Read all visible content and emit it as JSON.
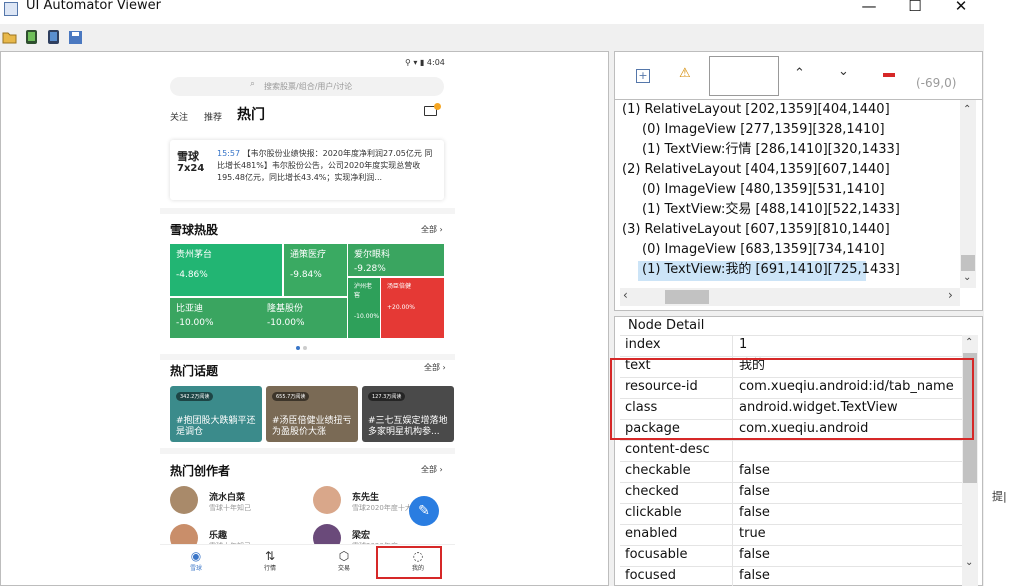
{
  "window": {
    "title": "UI Automator Viewer",
    "min": "—",
    "max": "☐",
    "close": "✕"
  },
  "toolbar": {
    "icons": [
      "folder-open-icon",
      "device-screenshot-icon",
      "device-screenshot-compressed-icon",
      "save-icon"
    ]
  },
  "phone": {
    "status_time": "4:04",
    "search_placeholder": "搜索股票/组合/用户/讨论",
    "tabs": [
      "关注",
      "推荐",
      "热门"
    ],
    "news": {
      "time": "15:57",
      "logo_top": "雪球",
      "logo_bottom": "7x24",
      "text": "【韦尔股份业绩快报：2020年度净利润27.05亿元 同比增长481%】韦尔股份公告，公司2020年度实现总营收195.48亿元，同比增长43.4%；实现净利润..."
    },
    "hot_stocks": {
      "title": "雪球热股",
      "all": "全部 ›",
      "items": [
        {
          "name": "贵州茅台",
          "change": "-4.86%",
          "color": "#22b573"
        },
        {
          "name": "通策医疗",
          "change": "-9.84%",
          "color": "#3aaa62"
        },
        {
          "name": "爱尔眼科",
          "change": "-9.28%",
          "color": "#3aa560"
        },
        {
          "name": "比亚迪",
          "change": "-10.00%",
          "color": "#3aa560"
        },
        {
          "name": "隆基股份",
          "change": "-10.00%",
          "color": "#3aa560"
        },
        {
          "name": "泸州老窖",
          "change": "-10.00%",
          "color": "#2ea05a"
        },
        {
          "name": "汤臣倍健",
          "change": "+20.00%",
          "color": "#e53935"
        }
      ]
    },
    "hot_topics": {
      "title": "热门话题",
      "all": "全部 ›",
      "items": [
        {
          "badge": "342.2万阅读",
          "text": "#抱团股大跌躺平还是调仓"
        },
        {
          "badge": "655.7万阅读",
          "text": "#汤臣倍健业绩扭亏为盈股价大涨"
        },
        {
          "badge": "127.3万阅读",
          "text": "#三七互娱定增落地多家明星机构参..."
        }
      ]
    },
    "creators": {
      "title": "热门创作者",
      "all": "全部 ›",
      "items": [
        {
          "name": "流水白菜",
          "desc": "雪球十年知己"
        },
        {
          "name": "东先生",
          "desc": "雪球2020年度十大..."
        },
        {
          "name": "乐趣",
          "desc": "雪球十年知己"
        },
        {
          "name": "梁宏",
          "desc": "雪球2020年度..."
        }
      ]
    },
    "bottom_nav": [
      "雪球",
      "行情",
      "交易",
      "我的"
    ]
  },
  "hierarchy": {
    "toolbar": {
      "coords": "(-69,0)"
    },
    "rows": [
      "(1) RelativeLayout [202,1359][404,1440]",
      "(0) ImageView [277,1359][328,1410]",
      "(1) TextView:行情 [286,1410][320,1433]",
      "(2) RelativeLayout [404,1359][607,1440]",
      "(0) ImageView [480,1359][531,1410]",
      "(1) TextView:交易 [488,1410][522,1433]",
      "(3) RelativeLayout [607,1359][810,1440]",
      "(0) ImageView [683,1359][734,1410]",
      "(1) TextView:我的 [691,1410][725,1433]"
    ]
  },
  "node_detail": {
    "title": "Node Detail",
    "props": [
      [
        "index",
        "1"
      ],
      [
        "text",
        "我的"
      ],
      [
        "resource-id",
        "com.xueqiu.android:id/tab_name"
      ],
      [
        "class",
        "android.widget.TextView"
      ],
      [
        "package",
        "com.xueqiu.android"
      ],
      [
        "content-desc",
        ""
      ],
      [
        "checkable",
        "false"
      ],
      [
        "checked",
        "false"
      ],
      [
        "clickable",
        "false"
      ],
      [
        "enabled",
        "true"
      ],
      [
        "focusable",
        "false"
      ],
      [
        "focused",
        "false"
      ]
    ]
  },
  "edge": {
    "label": "提|"
  }
}
